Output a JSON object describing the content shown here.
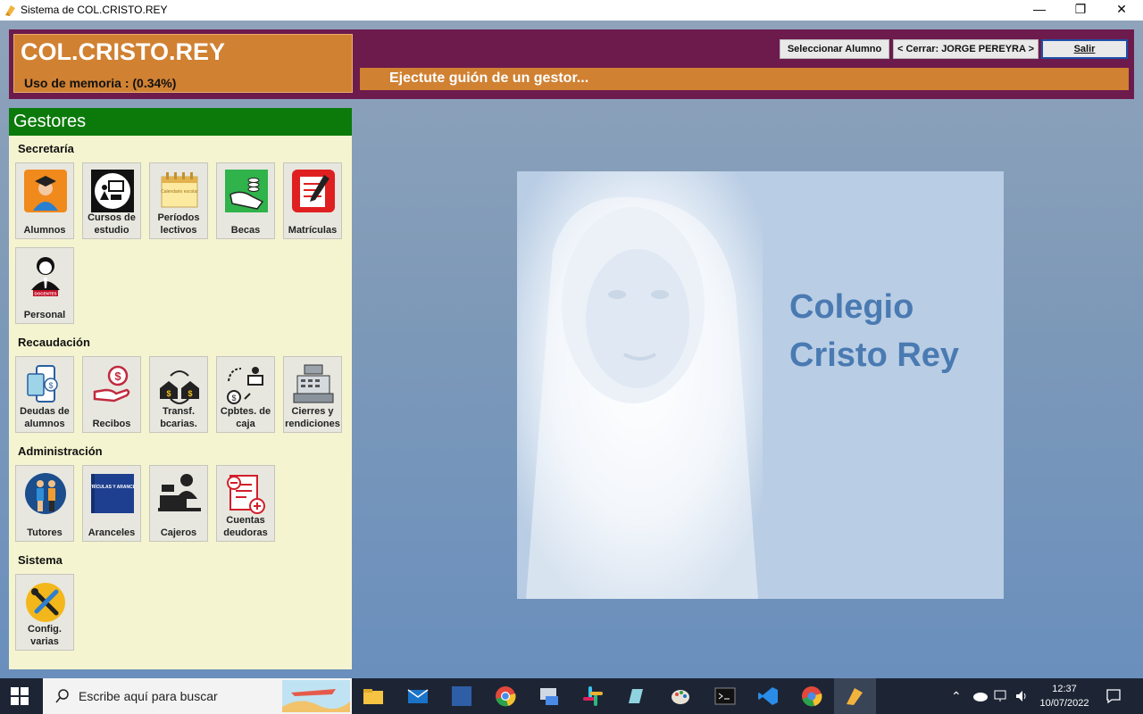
{
  "window": {
    "title": "Sistema de COL.CRISTO.REY",
    "min": "—",
    "max": "❐",
    "close": "✕"
  },
  "header": {
    "brand": "COL.CRISTO.REY",
    "memory": "Uso de memoria : (0.34%)",
    "status": "Ejectute guión de un gestor...",
    "buttons": {
      "select": "Seleccionar Alumno",
      "close_user": "< Cerrar: JORGE PEREYRA >",
      "exit": "Salir"
    }
  },
  "panel": {
    "title": "Gestores",
    "sections": {
      "secretaria": {
        "title": "Secretaría",
        "items": [
          "Alumnos",
          "Cursos de estudio",
          "Períodos lectivos",
          "Becas",
          "Matrículas",
          "Personal"
        ]
      },
      "recaudacion": {
        "title": "Recaudación",
        "items": [
          "Deudas de alumnos",
          "Recibos",
          "Transf. bcarias.",
          "Cpbtes. de caja",
          "Cierres y rendiciones"
        ]
      },
      "administracion": {
        "title": "Administración",
        "items": [
          "Tutores",
          "Aranceles",
          "Cajeros",
          "Cuentas deudoras"
        ]
      },
      "sistema": {
        "title": "Sistema",
        "items": [
          "Config. varias"
        ]
      }
    },
    "icon_texts": {
      "docentes": "DOCENTES",
      "aranceles": "MATRÍCULAS Y ARANCELES",
      "calendario": "Calendario escolar"
    }
  },
  "card": {
    "line1": "Colegio",
    "line2": "Cristo Rey"
  },
  "taskbar": {
    "search_placeholder": "Escribe aquí para buscar",
    "time": "12:37",
    "date": "10/07/2022"
  },
  "colors": {
    "accent_orange": "#d08132",
    "header_purple": "#6d1b4d",
    "panel_green": "#0b7a0b",
    "panel_bg": "#f5f4d0"
  }
}
